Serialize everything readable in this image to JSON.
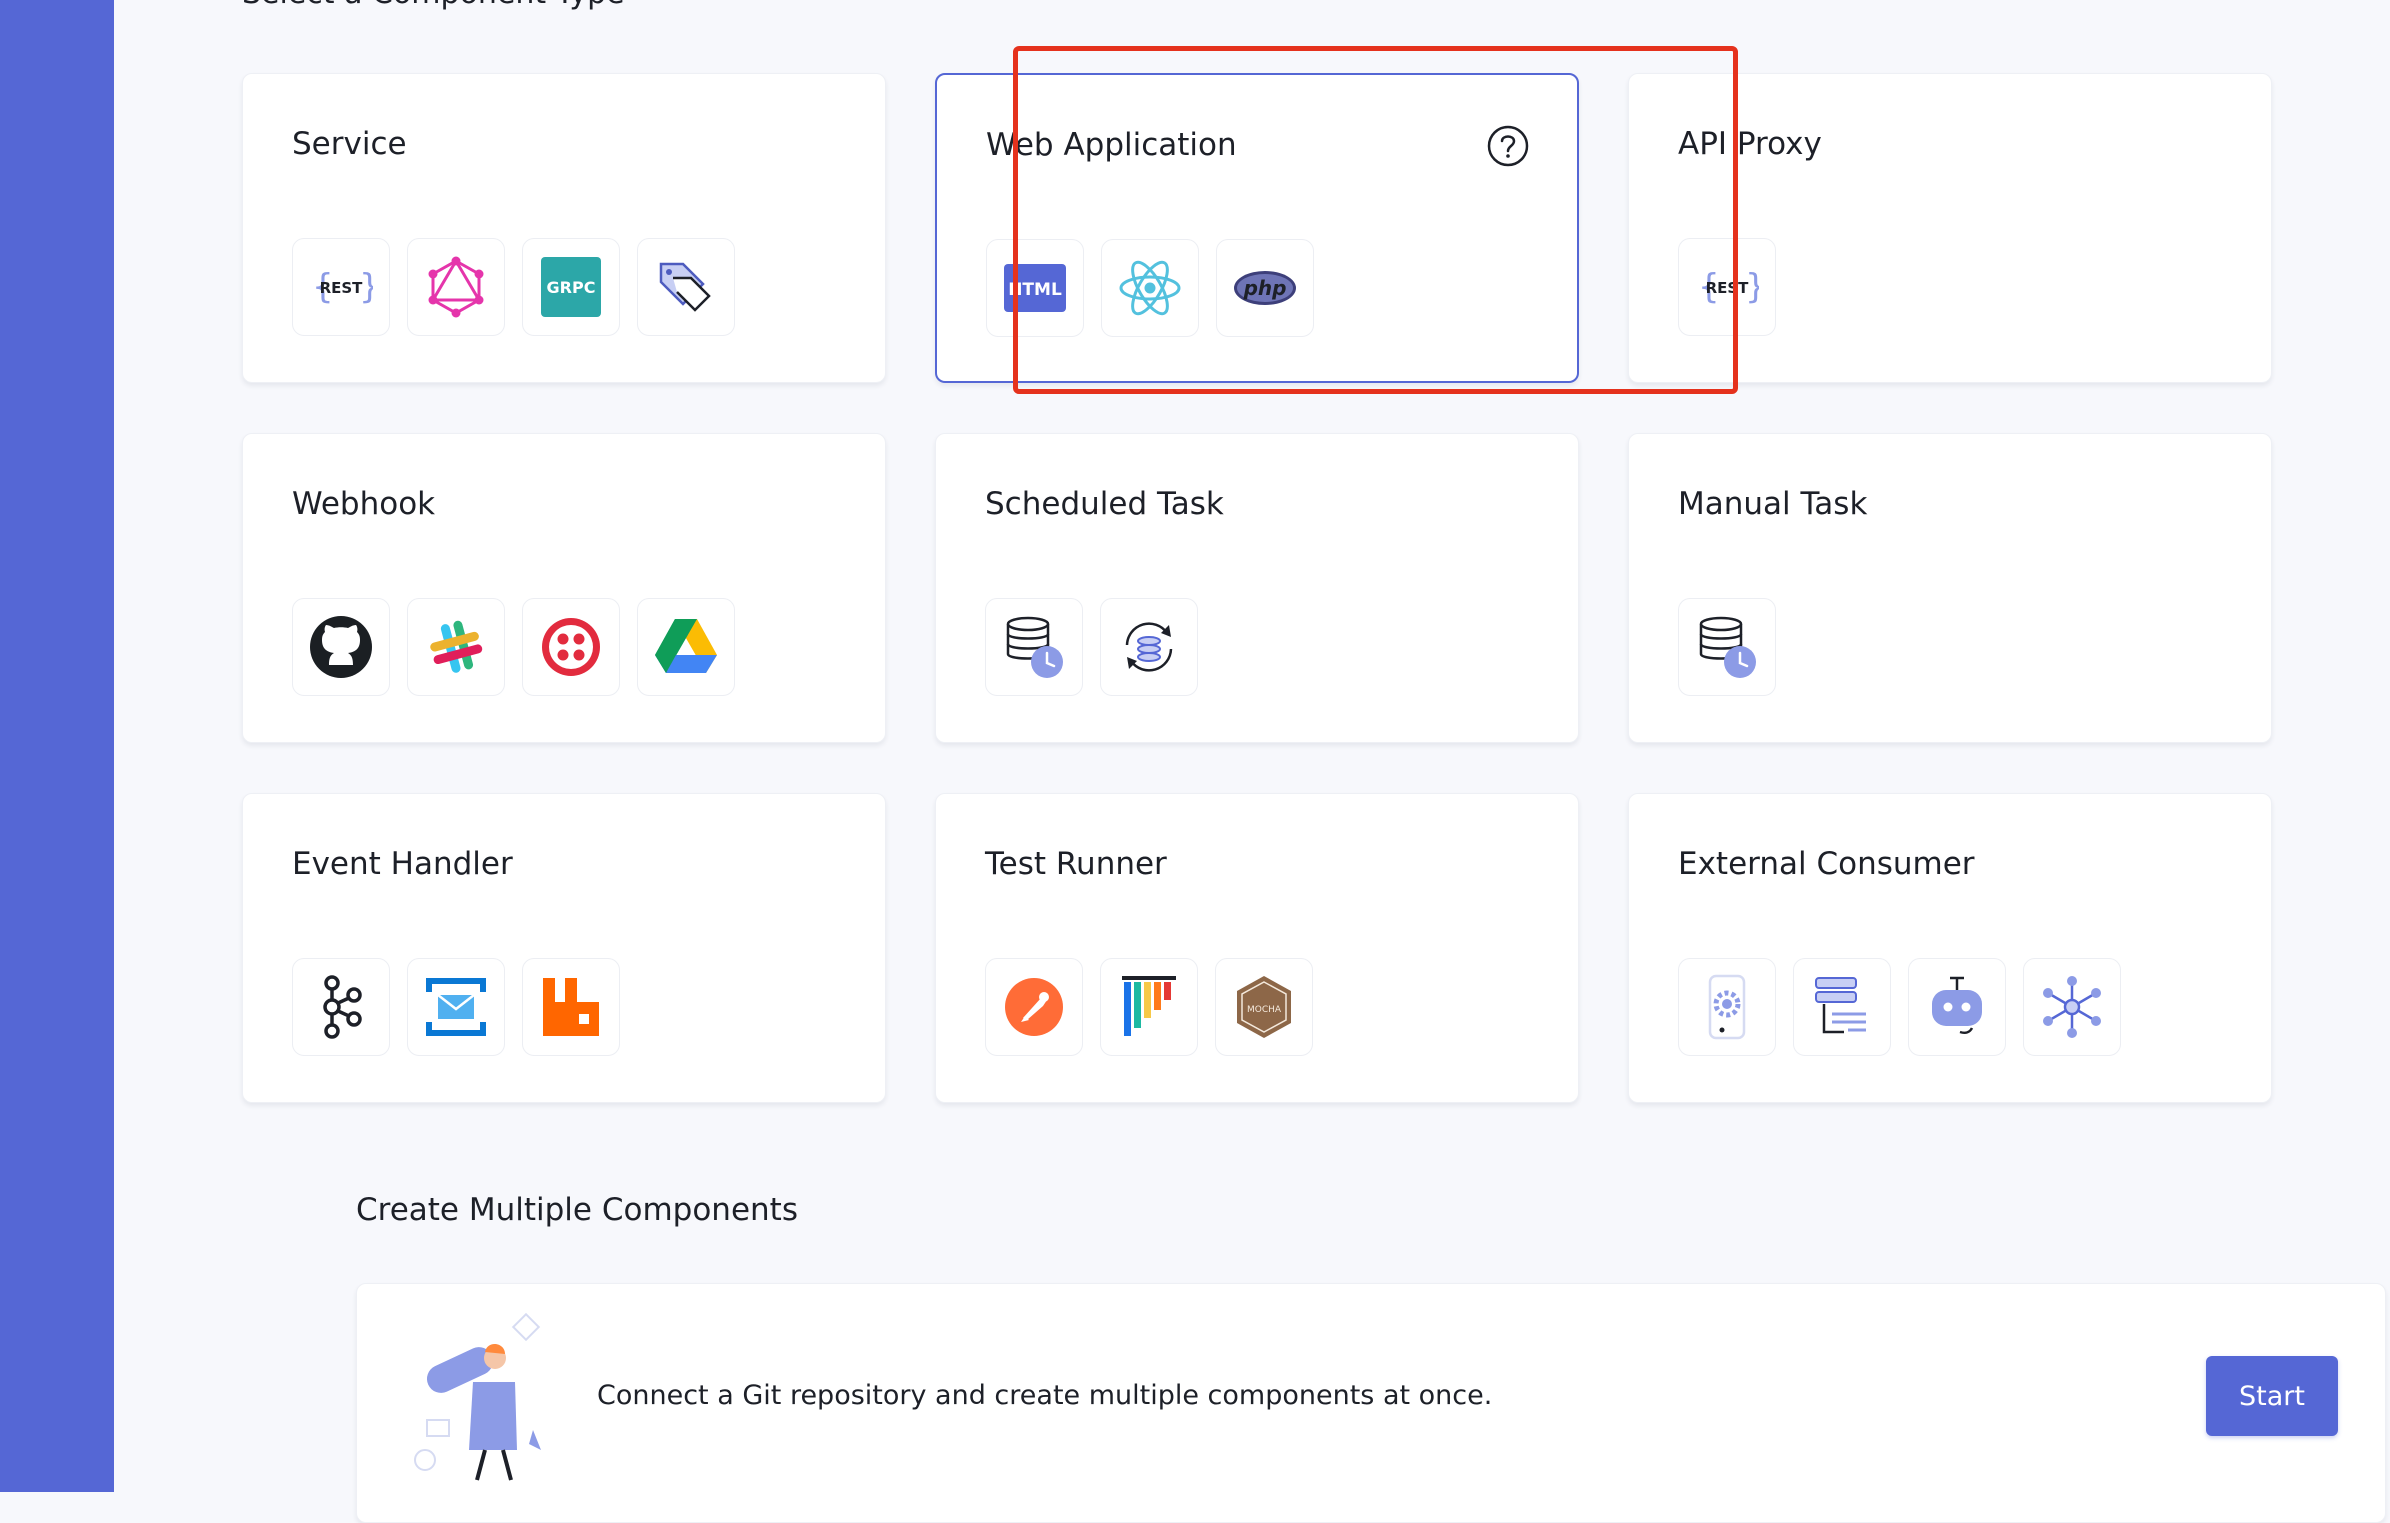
{
  "page": {
    "clipped_heading": "Select a Component Type"
  },
  "cards": [
    {
      "title": "Service",
      "icons": [
        "rest-api-icon",
        "graphql-icon",
        "grpc-icon",
        "tag-service-icon"
      ]
    },
    {
      "title": "Web Application",
      "icons": [
        "html-icon",
        "react-icon",
        "php-icon"
      ],
      "selected": true
    },
    {
      "title": "API Proxy",
      "icons": [
        "rest-api-icon"
      ]
    },
    {
      "title": "Webhook",
      "icons": [
        "github-icon",
        "slack-icon",
        "twilio-icon",
        "google-drive-icon"
      ]
    },
    {
      "title": "Scheduled Task",
      "icons": [
        "database-clock-icon",
        "database-sync-icon"
      ]
    },
    {
      "title": "Manual Task",
      "icons": [
        "database-clock-icon"
      ]
    },
    {
      "title": "Event Handler",
      "icons": [
        "kafka-icon",
        "azure-queue-icon",
        "rabbitmq-icon"
      ]
    },
    {
      "title": "Test Runner",
      "icons": [
        "postman-icon",
        "jmeter-icon",
        "mocha-icon"
      ]
    },
    {
      "title": "External Consumer",
      "icons": [
        "mobile-app-icon",
        "server-list-icon",
        "bot-icon",
        "network-hub-icon"
      ]
    }
  ],
  "icon_text": {
    "rest": "REST",
    "grpc": "GRPC",
    "html": "HTML",
    "php": "php",
    "mocha": "MOCHA"
  },
  "multi_components": {
    "section_title": "Create Multiple Components",
    "description": "Connect a Git repository and create multiple components at once.",
    "start_label": "Start"
  },
  "colors": {
    "sidebar": "#5567d5",
    "accent": "#5567d5",
    "highlight": "#e5321d",
    "background": "#f7f8fc"
  }
}
